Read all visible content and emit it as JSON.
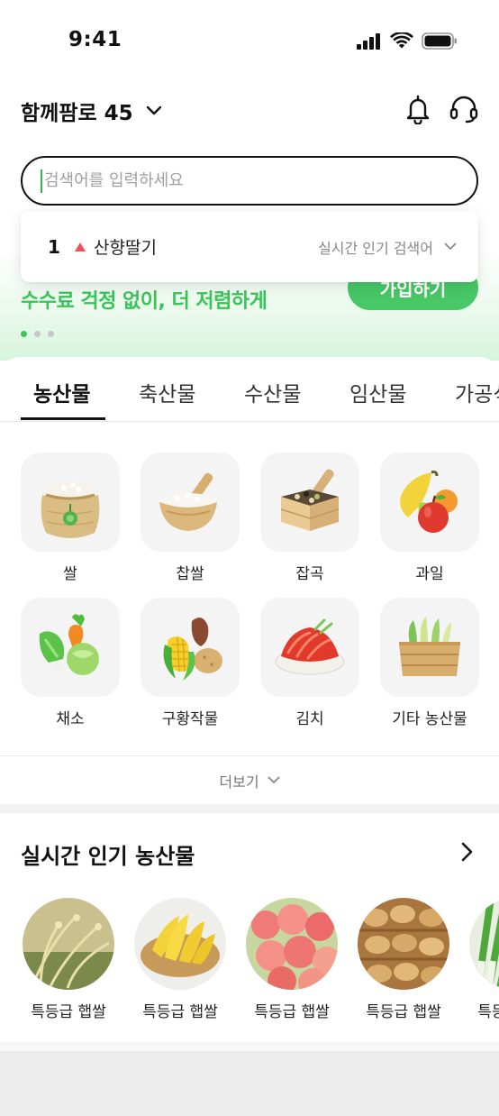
{
  "status": {
    "time": "9:41"
  },
  "header": {
    "location": "함께팜로 45"
  },
  "search": {
    "placeholder": "검색어를 입력하세요"
  },
  "banner": {
    "text": "수수료 걱정 없이, 더 저렴하게",
    "button": "가입하기"
  },
  "trending": {
    "rank": "1",
    "keyword": "산향딸기",
    "label": "실시간 인기 검색어"
  },
  "tabs": [
    "농산물",
    "축산물",
    "수산물",
    "임산물",
    "가공식품"
  ],
  "categories": [
    "쌀",
    "찹쌀",
    "잡곡",
    "과일",
    "채소",
    "구황작물",
    "김치",
    "기타 농산물"
  ],
  "more": "더보기",
  "popular": {
    "title": "실시간 인기 농산물",
    "items": [
      "특등급 햅쌀",
      "특등급 햅쌀",
      "특등급 햅쌀",
      "특등급 햅쌀",
      "특등급 햅쌀"
    ]
  },
  "colors": {
    "accent": "#47c766",
    "text": "#111111",
    "trend": "#f0505a"
  }
}
